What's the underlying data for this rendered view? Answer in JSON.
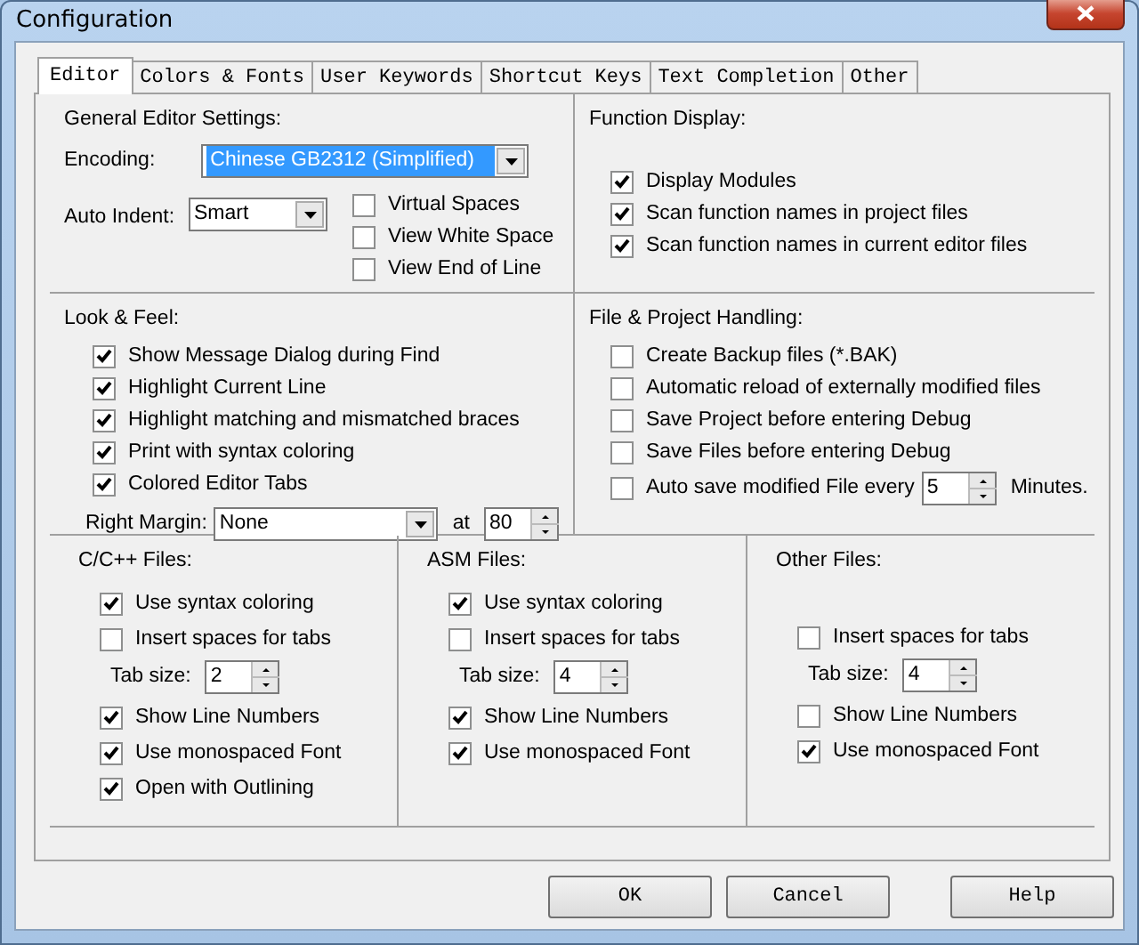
{
  "window": {
    "title": "Configuration"
  },
  "tabs": [
    {
      "label": "Editor",
      "selected": true
    },
    {
      "label": "Colors & Fonts",
      "selected": false
    },
    {
      "label": "User Keywords",
      "selected": false
    },
    {
      "label": "Shortcut Keys",
      "selected": false
    },
    {
      "label": "Text Completion",
      "selected": false
    },
    {
      "label": "Other",
      "selected": false
    }
  ],
  "general": {
    "title": "General Editor Settings:",
    "encoding": {
      "label": "Encoding:",
      "value": "Chinese GB2312 (Simplified)",
      "highlighted": true
    },
    "auto_indent": {
      "label": "Auto Indent:",
      "value": "Smart",
      "highlighted": false
    },
    "options": [
      {
        "label": "Virtual Spaces",
        "checked": false
      },
      {
        "label": "View White Space",
        "checked": false
      },
      {
        "label": "View End of Line",
        "checked": false
      }
    ]
  },
  "function_display": {
    "title": "Function Display:",
    "options": [
      {
        "label": "Display Modules",
        "checked": true
      },
      {
        "label": "Scan function names in project files",
        "checked": true
      },
      {
        "label": "Scan function names in current editor files",
        "checked": true
      }
    ]
  },
  "look_and_feel": {
    "title": "Look & Feel:",
    "options": [
      {
        "label": "Show Message Dialog during Find",
        "checked": true
      },
      {
        "label": "Highlight Current Line",
        "checked": true
      },
      {
        "label": "Highlight matching and mismatched braces",
        "checked": true
      },
      {
        "label": "Print with syntax coloring",
        "checked": true
      },
      {
        "label": "Colored Editor Tabs",
        "checked": true
      }
    ],
    "right_margin": {
      "label": "Right Margin:",
      "value": "None"
    },
    "at": {
      "label": "at",
      "value": "80"
    }
  },
  "file_handling": {
    "title": "File & Project Handling:",
    "options": [
      {
        "label": "Create Backup files (*.BAK)",
        "checked": false
      },
      {
        "label": "Automatic reload of externally modified files",
        "checked": false
      },
      {
        "label": "Save Project before entering Debug",
        "checked": false
      },
      {
        "label": "Save Files before entering Debug",
        "checked": false
      }
    ],
    "auto_save": {
      "label": "Auto save modified File every",
      "checked": false,
      "value": "5",
      "unit": "Minutes."
    }
  },
  "file_types": [
    {
      "title": "C/C++ Files:",
      "items": [
        {
          "kind": "checkbox",
          "label": "Use syntax coloring",
          "checked": true
        },
        {
          "kind": "checkbox",
          "label": "Insert spaces for tabs",
          "checked": false
        },
        {
          "kind": "tab_size",
          "label": "Tab size:",
          "value": "2"
        },
        {
          "kind": "checkbox",
          "label": "Show Line Numbers",
          "checked": true
        },
        {
          "kind": "checkbox",
          "label": "Use monospaced Font",
          "checked": true
        },
        {
          "kind": "checkbox",
          "label": "Open with Outlining",
          "checked": true
        }
      ]
    },
    {
      "title": "ASM Files:",
      "items": [
        {
          "kind": "checkbox",
          "label": "Use syntax coloring",
          "checked": true
        },
        {
          "kind": "checkbox",
          "label": "Insert spaces for tabs",
          "checked": false
        },
        {
          "kind": "tab_size",
          "label": "Tab size:",
          "value": "4"
        },
        {
          "kind": "checkbox",
          "label": "Show Line Numbers",
          "checked": true
        },
        {
          "kind": "checkbox",
          "label": "Use monospaced Font",
          "checked": true
        }
      ]
    },
    {
      "title": "Other Files:",
      "items": [
        {
          "kind": "checkbox",
          "label": "Insert spaces for tabs",
          "checked": false
        },
        {
          "kind": "tab_size",
          "label": "Tab size:",
          "value": "4"
        },
        {
          "kind": "checkbox",
          "label": "Show Line Numbers",
          "checked": false
        },
        {
          "kind": "checkbox",
          "label": "Use monospaced Font",
          "checked": true
        }
      ]
    }
  ],
  "buttons": [
    "OK",
    "Cancel",
    "Help"
  ]
}
